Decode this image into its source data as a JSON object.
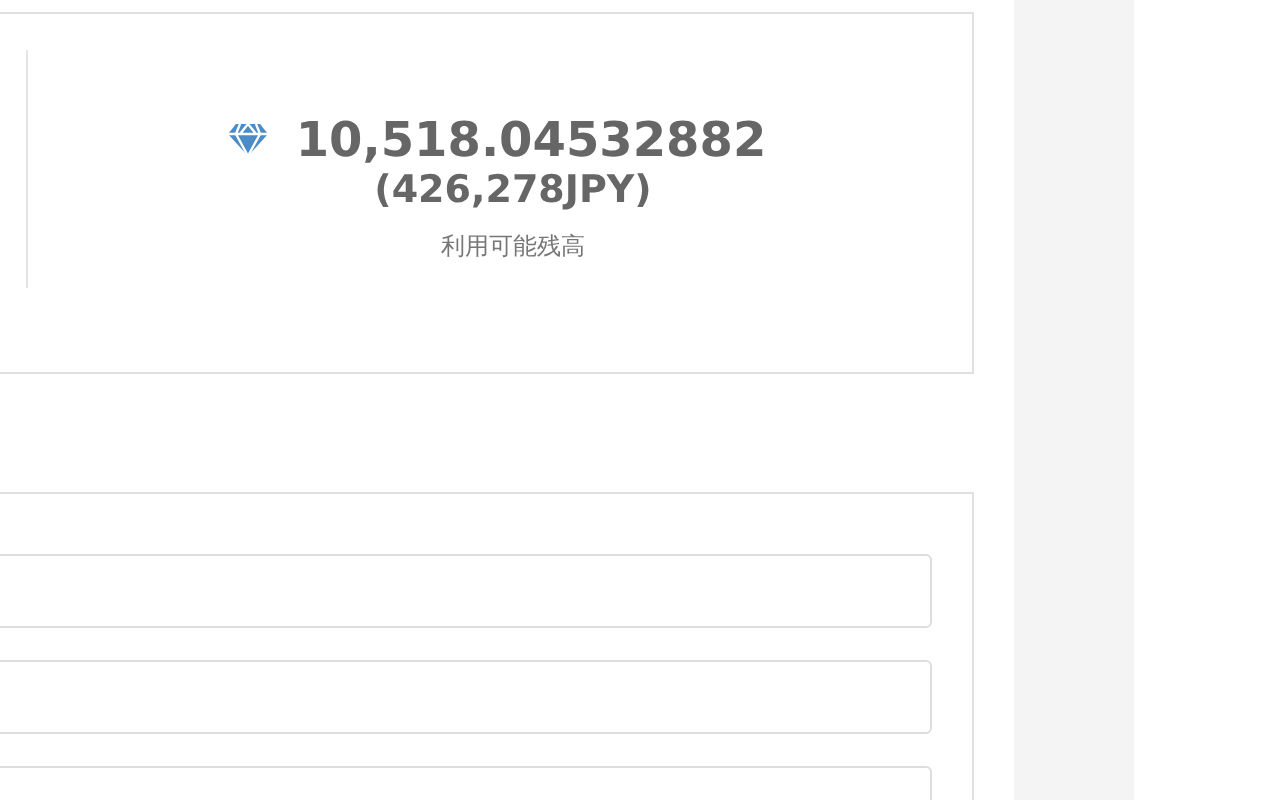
{
  "balance": {
    "amount": "10,518.04532882",
    "converted": "(426,278JPY)",
    "label": "利用可能残高"
  },
  "form": {
    "fields": [
      {
        "kind": "text"
      },
      {
        "kind": "text"
      },
      {
        "kind": "text"
      }
    ]
  }
}
